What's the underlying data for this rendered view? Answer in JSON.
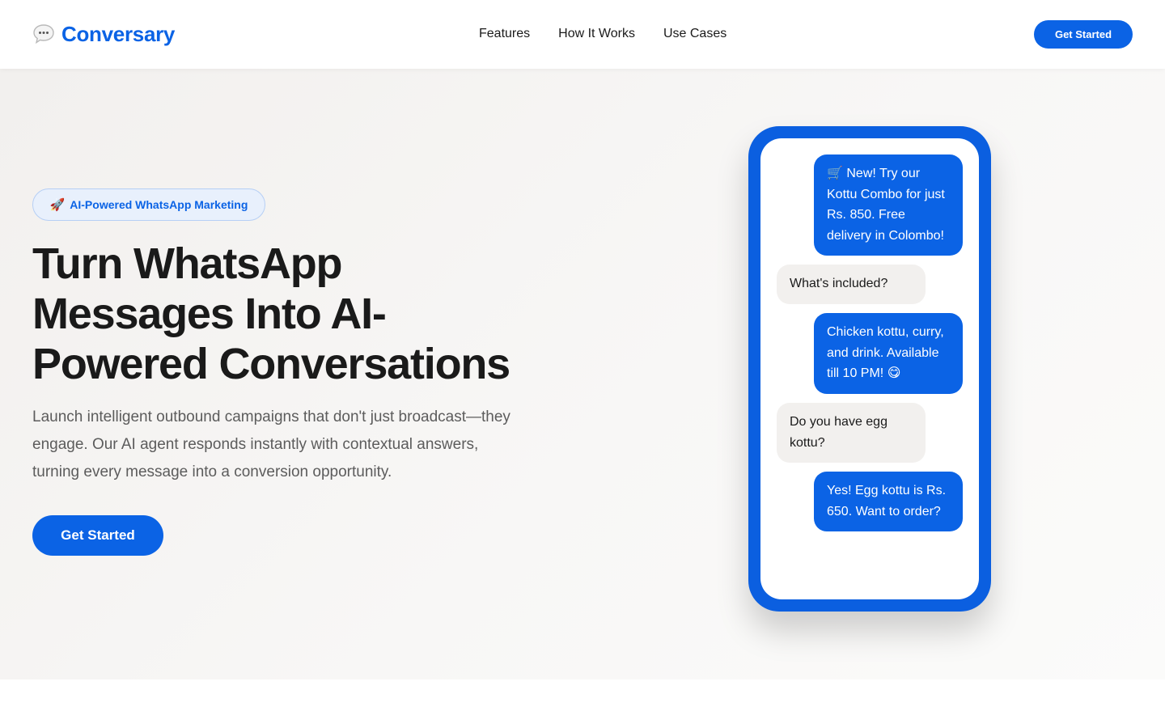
{
  "header": {
    "brand": "Conversary",
    "brand_icon": "speech-bubble-icon",
    "nav": [
      "Features",
      "How It Works",
      "Use Cases"
    ],
    "cta_label": "Get Started"
  },
  "hero": {
    "badge_icon": "🚀",
    "badge_label": "AI-Powered WhatsApp Marketing",
    "headline": "Turn WhatsApp Messages Into AI-Powered Conversations",
    "subhead": "Launch intelligent outbound campaigns that don't just broadcast—they engage. Our AI agent responds instantly with contextual answers, turning every message into a conversion opportunity.",
    "cta_label": "Get Started"
  },
  "chat": {
    "messages": [
      {
        "from": "business",
        "text": "🛒 New! Try our Kottu Combo for just Rs. 850. Free delivery in Colombo!"
      },
      {
        "from": "customer",
        "text": "What's included?"
      },
      {
        "from": "business",
        "text": "Chicken kottu, curry, and drink. Available till 10 PM! 😋"
      },
      {
        "from": "customer",
        "text": "Do you have egg kottu?"
      },
      {
        "from": "business",
        "text": "Yes! Egg kottu is Rs. 650. Want to order?"
      }
    ]
  },
  "colors": {
    "brand_blue": "#0b63e5",
    "badge_bg": "#e8f0fc",
    "incoming_bubble": "#f2f0ee"
  }
}
